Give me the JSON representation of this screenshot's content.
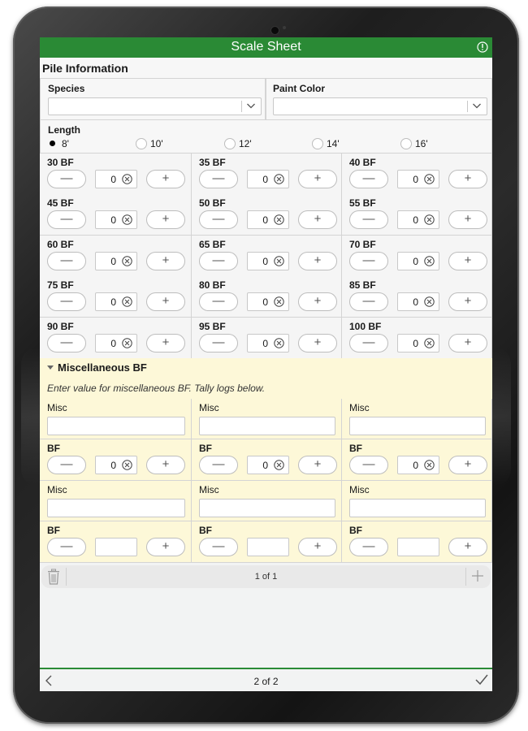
{
  "app": {
    "title": "Scale Sheet"
  },
  "pile": {
    "section_title": "Pile Information",
    "species_label": "Species",
    "species_value": "",
    "paint_label": "Paint Color",
    "paint_value": "",
    "length_label": "Length",
    "length_options": [
      "8'",
      "10'",
      "12'",
      "14'",
      "16'"
    ],
    "length_selected": "8'"
  },
  "tally": [
    {
      "label": "30 BF",
      "value": "0"
    },
    {
      "label": "35 BF",
      "value": "0"
    },
    {
      "label": "40 BF",
      "value": "0"
    },
    {
      "label": "45 BF",
      "value": "0"
    },
    {
      "label": "50 BF",
      "value": "0"
    },
    {
      "label": "55 BF",
      "value": "0"
    },
    {
      "label": "60 BF",
      "value": "0"
    },
    {
      "label": "65 BF",
      "value": "0"
    },
    {
      "label": "70 BF",
      "value": "0"
    },
    {
      "label": "75 BF",
      "value": "0"
    },
    {
      "label": "80 BF",
      "value": "0"
    },
    {
      "label": "85 BF",
      "value": "0"
    },
    {
      "label": "90 BF",
      "value": "0"
    },
    {
      "label": "95 BF",
      "value": "0"
    },
    {
      "label": "100 BF",
      "value": "0"
    }
  ],
  "stepper": {
    "minus": "—",
    "plus": "+"
  },
  "misc": {
    "header": "Miscellaneous BF",
    "note": "Enter value for miscellaneous BF. Tally logs below.",
    "misc_label": "Misc",
    "bf_label": "BF",
    "row1": [
      {
        "misc": "",
        "bf": "0"
      },
      {
        "misc": "",
        "bf": "0"
      },
      {
        "misc": "",
        "bf": "0"
      }
    ],
    "row2": [
      {
        "misc": "",
        "bf": ""
      },
      {
        "misc": "",
        "bf": ""
      },
      {
        "misc": "",
        "bf": ""
      }
    ]
  },
  "repeat_pager": {
    "text": "1 of 1"
  },
  "footer": {
    "page": "2 of 2"
  },
  "colors": {
    "brand_green": "#2a8a35",
    "misc_yellow": "#fdf8d8"
  }
}
